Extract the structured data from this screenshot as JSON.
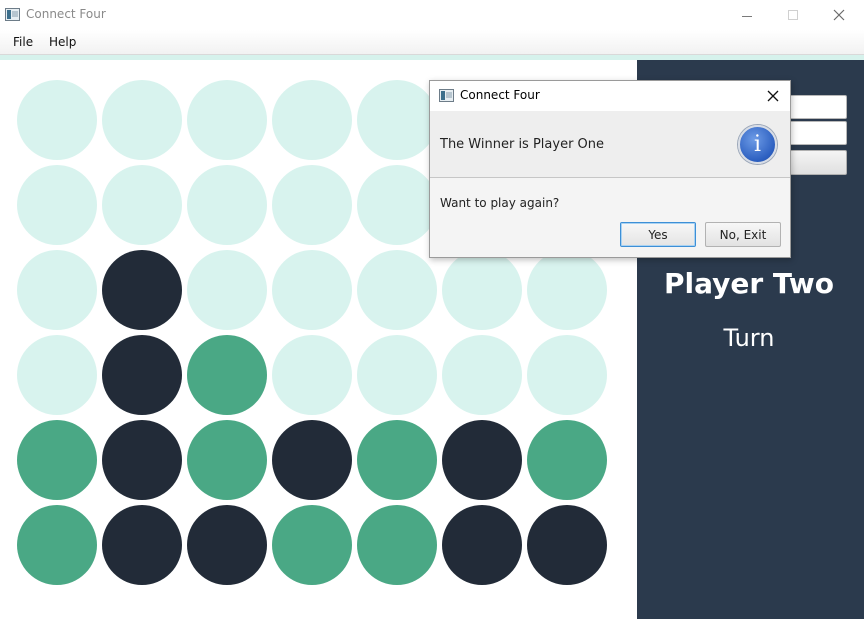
{
  "window": {
    "title": "Connect Four",
    "controls": {
      "minimize_icon": "minimize-icon",
      "maximize_icon": "maximize-icon",
      "close_icon": "close-icon"
    }
  },
  "menu": {
    "items": [
      {
        "label": "File"
      },
      {
        "label": "Help"
      }
    ]
  },
  "board": {
    "columns": 7,
    "rows": 6,
    "legend": {
      "empty": "empty",
      "one": "player-one",
      "two": "player-two"
    },
    "grid": [
      [
        "empty",
        "empty",
        "empty",
        "empty",
        "empty",
        "empty",
        "empty"
      ],
      [
        "empty",
        "empty",
        "empty",
        "empty",
        "empty",
        "empty",
        "empty"
      ],
      [
        "empty",
        "two",
        "empty",
        "empty",
        "empty",
        "empty",
        "empty"
      ],
      [
        "empty",
        "two",
        "one",
        "empty",
        "empty",
        "empty",
        "empty"
      ],
      [
        "one",
        "two",
        "one",
        "two",
        "one",
        "two",
        "one"
      ],
      [
        "one",
        "two",
        "two",
        "one",
        "one",
        "two",
        "two"
      ]
    ]
  },
  "colors": {
    "empty": "#d8f3ee",
    "player_one": "#4aa885",
    "player_two": "#222b38",
    "side_panel": "#2b3a4d",
    "accent_strip": "#d6f2ec"
  },
  "side_panel": {
    "player_name": "Player Two",
    "status": "Turn"
  },
  "dialog": {
    "title": "Connect Four",
    "header": "The Winner is Player One",
    "icon": "info-icon",
    "icon_glyph": "i",
    "content": "Want to play again?",
    "buttons": {
      "yes": "Yes",
      "no": "No, Exit"
    },
    "default_button": "Yes"
  }
}
